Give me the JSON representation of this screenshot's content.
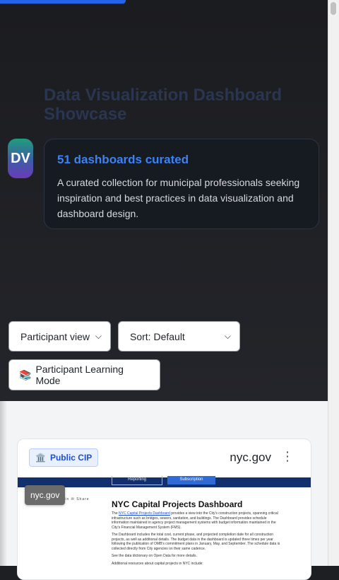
{
  "hero": {
    "title": "Data Visualization Dashboard Showcase",
    "avatar_initials": "DV"
  },
  "intro_card": {
    "heading": "51 dashboards curated",
    "description": "A curated collection for municipal professionals seeking inspiration and best practices in data visualization and dashboard design."
  },
  "controls": {
    "view_select": {
      "selected": "Participant view"
    },
    "sort_select": {
      "selected": "Sort: Default"
    },
    "mode_button": {
      "icon": "books-emoji",
      "emoji": "📚",
      "label": "Participant Learning Mode"
    }
  },
  "dashboard_card": {
    "badge": {
      "icon": "🏛️",
      "label": "Public CIP"
    },
    "domain": "nyc.gov",
    "menu_icon": "⋮",
    "tooltip": "nyc.gov",
    "preview": {
      "nav_tabs": [
        "Reporting",
        "Subscription"
      ],
      "social": "f ✕ in ✉ Share",
      "title": "NYC Capital Projects Dashboard",
      "para1_prefix": "The ",
      "para1_link": "NYC Capital Projects Dashboard",
      "para1_rest": " provides a view into the City's construction projects, spanning critical infrastructure such as bridges, sewers, sanitation, and buildings. The Dashboard provides schedule information maintained in agency project management systems with budget information maintained in the City's Financial Management System (FMS).",
      "para2": "The Dashboard includes the total cost, current phase, and projected completion date for all construction projects, as well as additional details. The budget data in the dashboard is updated three times per year following the publication of OMB's commitment plans in January, May, and September. The schedule data is collected directly from City agencies on their same cadence.",
      "para3": "See the data dictionary on Open Data for more details.",
      "para4": "Additional resources about capital projects in NYC include:"
    }
  },
  "colors": {
    "accent": "#3b82f6",
    "progress": "#2563eb",
    "badge_text": "#1d4ed8"
  }
}
